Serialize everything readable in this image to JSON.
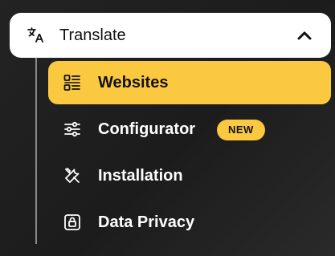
{
  "group": {
    "label": "Translate",
    "icon": "translate-icon",
    "expanded": true,
    "chevron_icon": "chevron-up-icon"
  },
  "items": [
    {
      "label": "Websites",
      "icon": "list-icon",
      "active": true
    },
    {
      "label": "Configurator",
      "icon": "sliders-icon",
      "badge": "NEW"
    },
    {
      "label": "Installation",
      "icon": "tools-icon"
    },
    {
      "label": "Data Privacy",
      "icon": "lock-icon"
    }
  ],
  "colors": {
    "accent": "#fbc93f",
    "background": "#1f1f1f",
    "header_bg": "#ffffff",
    "text_light": "#ffffff",
    "text_dark": "#111111"
  }
}
